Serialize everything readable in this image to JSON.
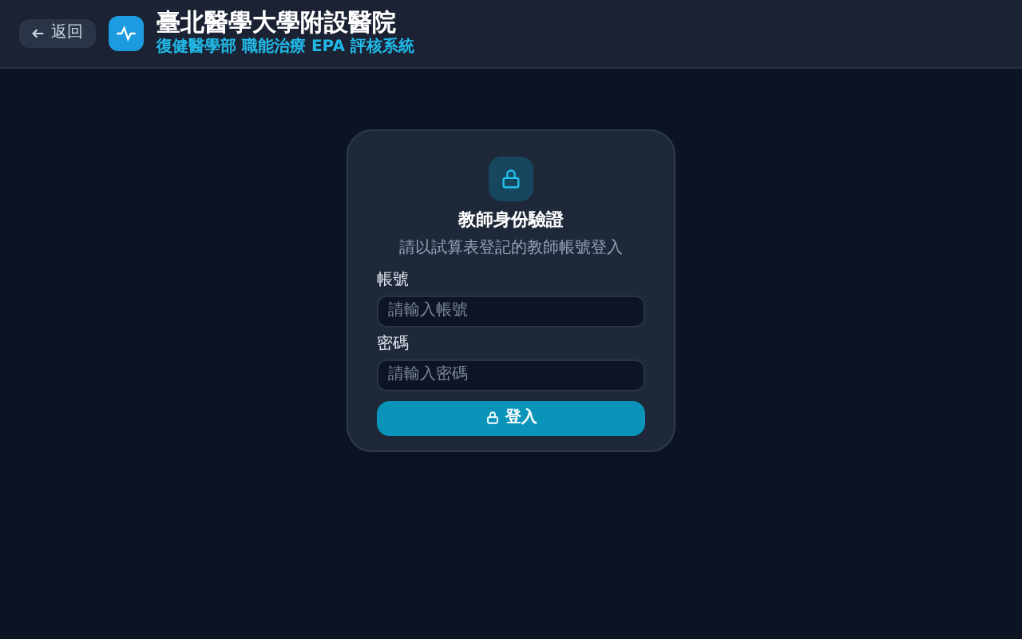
{
  "header": {
    "back_button": "返回",
    "title": "臺北醫學大學附設醫院",
    "subtitle": "復健醫學部 職能治療 EPA 評核系統"
  },
  "login_card": {
    "title": "教師身份驗證",
    "description": "請以試算表登記的教師帳號登入",
    "fields": [
      {
        "label": "帳號",
        "placeholder": "請輸入帳號"
      },
      {
        "label": "密碼",
        "placeholder": "請輸入密碼"
      }
    ],
    "submit": "登入"
  }
}
